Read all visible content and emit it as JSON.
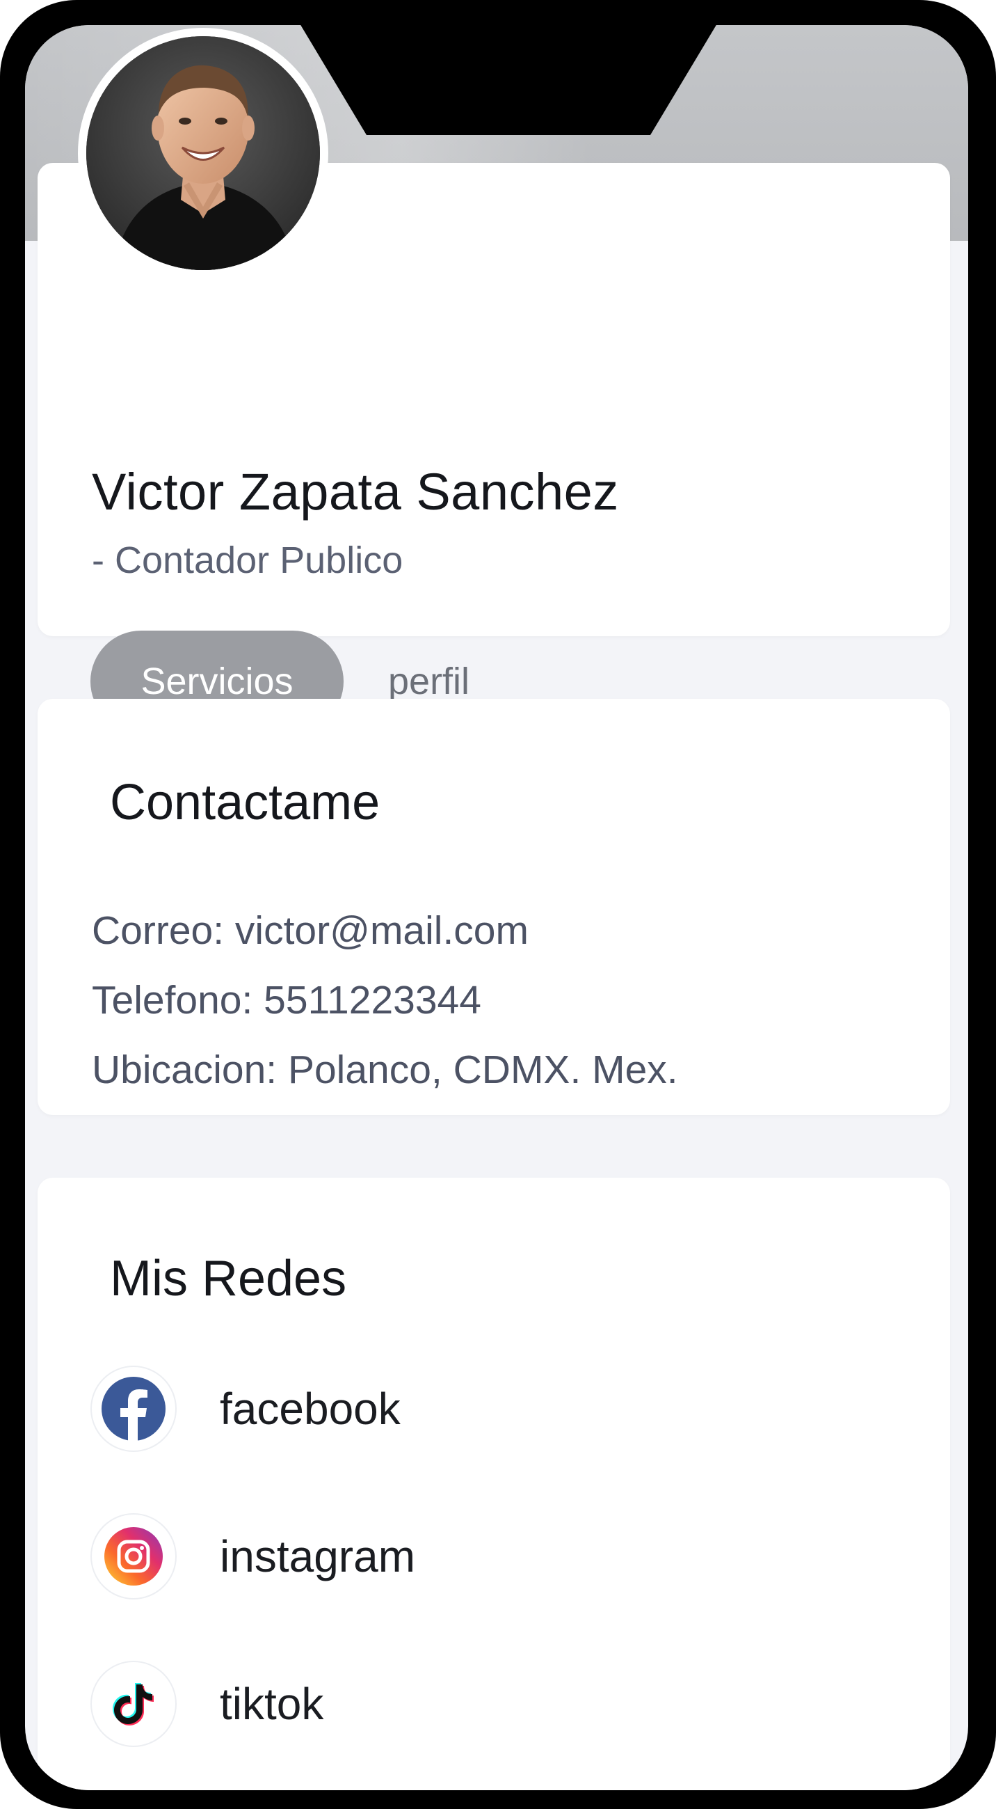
{
  "profile": {
    "name": "Victor Zapata Sanchez",
    "role": "- Contador Publico",
    "tabs": [
      {
        "label": "Servicios",
        "active": true
      },
      {
        "label": "perfil",
        "active": false
      }
    ]
  },
  "contact": {
    "title": "Contactame",
    "lines": [
      "Correo: victor@mail.com",
      "Telefono: 5511223344",
      "Ubicacion: Polanco, CDMX. Mex."
    ]
  },
  "social": {
    "title": "Mis Redes",
    "items": [
      {
        "label": "facebook",
        "icon": "facebook-icon"
      },
      {
        "label": "instagram",
        "icon": "instagram-icon"
      },
      {
        "label": "tiktok",
        "icon": "tiktok-icon"
      }
    ]
  },
  "colors": {
    "accent_pill": "#9b9da2",
    "facebook": "#3b5998",
    "header_band": "#bfc1c4"
  }
}
